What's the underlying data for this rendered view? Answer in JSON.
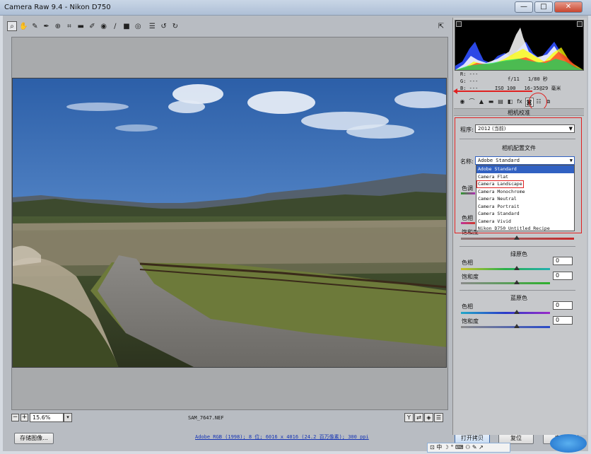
{
  "window": {
    "title": "Camera Raw 9.4 -  Nikon D750",
    "minimize": "—",
    "maximize": "□",
    "close": "✕"
  },
  "toolbar": {
    "tools": [
      {
        "name": "zoom-icon",
        "glyph": "⌕"
      },
      {
        "name": "hand-icon",
        "glyph": "✋"
      },
      {
        "name": "white-balance-icon",
        "glyph": "✎"
      },
      {
        "name": "color-sampler-icon",
        "glyph": "✒"
      },
      {
        "name": "target-adjust-icon",
        "glyph": "⊕"
      },
      {
        "name": "crop-icon",
        "glyph": "⌗"
      },
      {
        "name": "straighten-icon",
        "glyph": "▬"
      },
      {
        "name": "spot-removal-icon",
        "glyph": "✐"
      },
      {
        "name": "red-eye-icon",
        "glyph": "◉"
      },
      {
        "name": "adjustment-brush-icon",
        "glyph": "∕"
      },
      {
        "name": "graduated-filter-icon",
        "glyph": "■"
      },
      {
        "name": "radial-filter-icon",
        "glyph": "◎"
      },
      {
        "name": "preferences-icon",
        "glyph": "☰"
      },
      {
        "name": "rotate-ccw-icon",
        "glyph": "↺"
      },
      {
        "name": "rotate-cw-icon",
        "glyph": "↻"
      }
    ],
    "fullscreen_glyph": "⇱"
  },
  "zoom": {
    "minus": "−",
    "plus": "+",
    "value": "15.6%",
    "arrow": "▾"
  },
  "filename": "SAM_7647.NEF",
  "view_buttons": [
    "Y",
    "⇄",
    "◈",
    "☰"
  ],
  "footer": {
    "save_label": "存储图像...",
    "workflow_link": "Adobe RGB (1998); 8 位; 6016 x 4016 (24.2 百万像素); 300 ppi",
    "open_label": "打开拷贝",
    "reset_label": "复位",
    "done_label": "完成"
  },
  "readout": {
    "r": "R:  ---",
    "g": "G:  ---",
    "b": "B:  ---"
  },
  "exif": {
    "aperture": "f/11",
    "shutter": "1/80 秒",
    "iso": "ISO 100",
    "lens": "16-35@29 毫米"
  },
  "tabs": [
    "◉",
    "⌒",
    "▲",
    "▬",
    "▤",
    "◧",
    "fx",
    "◙",
    "☷",
    "⧉"
  ],
  "panel": {
    "title": "相机校准",
    "process_label": "程序:",
    "process_value": "2012 (当前)",
    "profile_section": "相机配置文件",
    "name_label": "名称:",
    "name_value": "Adobe Standard",
    "profiles": [
      "Adobe Standard",
      "Camera Flat",
      "Camera Landscape",
      "Camera Monochrome",
      "Camera Neutral",
      "Camera Portrait",
      "Camera Standard",
      "Camera Vivid",
      "Nikon D750 Untitled Recipe"
    ],
    "shadows_tint_label": "色调",
    "red_hue_label": "色相",
    "red_sat_label": "饱和度",
    "green_section": "绿原色",
    "green_hue_label": "色相",
    "green_hue_value": "0",
    "green_sat_label": "饱和度",
    "green_sat_value": "0",
    "blue_section": "蓝原色",
    "blue_hue_label": "色相",
    "blue_hue_value": "0",
    "blue_sat_label": "饱和度",
    "blue_sat_value": "0"
  },
  "ime": "⊡ 中 ☽ ° ⌨ ⚇ ✎ ↗",
  "colors": {
    "accent": "#e02020",
    "selection": "#3161c2",
    "sky": "#3a6fb8",
    "link": "#1433b4"
  }
}
